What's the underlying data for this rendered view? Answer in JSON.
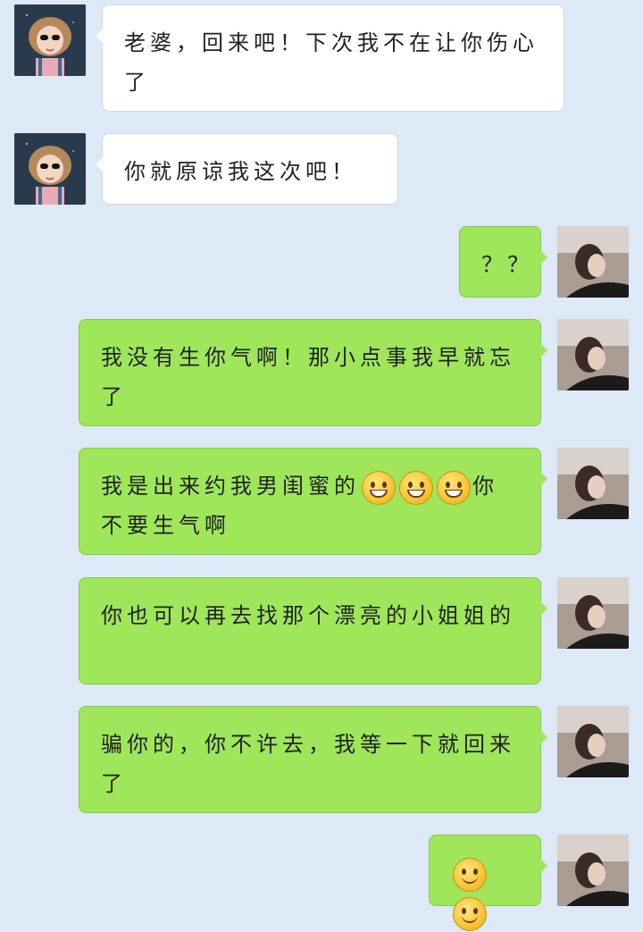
{
  "colors": {
    "background": "#dde9f6",
    "incoming_bubble": "#ffffff",
    "outgoing_bubble": "#9fe65b"
  },
  "messages": [
    {
      "side": "incoming",
      "avatar": "cartoon-girl-avatar",
      "parts": [
        "老婆，回来吧！下次我不在让你伤心了"
      ]
    },
    {
      "side": "incoming",
      "avatar": "cartoon-girl-avatar",
      "parts": [
        "你就原谅我这次吧！"
      ]
    },
    {
      "side": "outgoing",
      "avatar": "woman-photo-avatar",
      "parts": [
        "？？"
      ]
    },
    {
      "side": "outgoing",
      "avatar": "woman-photo-avatar",
      "parts": [
        "我没有生你气啊！那小点事我早就忘了"
      ]
    },
    {
      "side": "outgoing",
      "avatar": "woman-photo-avatar",
      "parts": [
        "我是出来约我男闺蜜的",
        "grin-emoji",
        "grin-emoji",
        "grin-emoji",
        "你不要生气啊"
      ]
    },
    {
      "side": "outgoing",
      "avatar": "woman-photo-avatar",
      "parts": [
        "你也可以再去找那个漂亮的小姐姐的"
      ]
    },
    {
      "side": "outgoing",
      "avatar": "woman-photo-avatar",
      "parts": [
        "骗你的，你不许去，我等一下就回来了"
      ]
    },
    {
      "side": "outgoing",
      "avatar": "woman-photo-avatar",
      "parts": [
        "smile-emoji",
        "smile-emoji"
      ]
    }
  ]
}
